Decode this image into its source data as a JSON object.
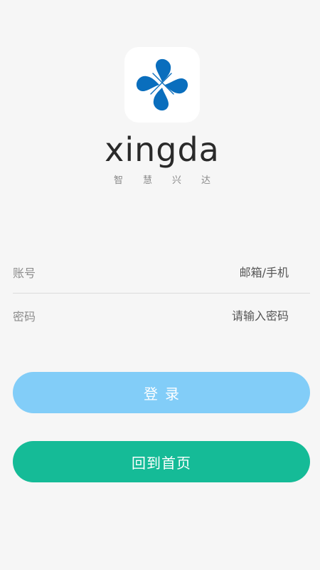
{
  "brand": {
    "logo_icon": "xingda-clover-logo-icon",
    "name": "xingda",
    "tagline": "智慧兴达"
  },
  "form": {
    "account_label": "账号",
    "account_placeholder": "邮箱/手机",
    "password_label": "密码",
    "password_placeholder": "请输入密码"
  },
  "buttons": {
    "login_label": "登录",
    "home_label": "回到首页"
  },
  "colors": {
    "logo_blue": "#0a6ebd",
    "login_button": "#82cdf8",
    "home_button": "#15bb97",
    "background": "#f6f6f6"
  }
}
